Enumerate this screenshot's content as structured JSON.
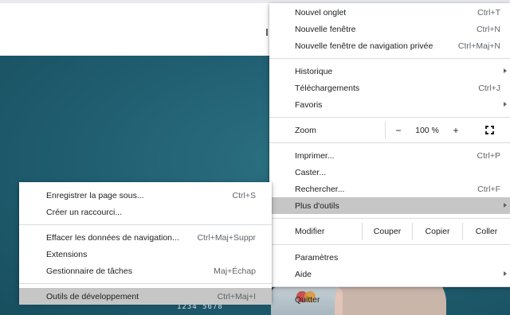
{
  "main_menu": {
    "items_group1": [
      {
        "label": "Nouvel onglet",
        "shortcut": "Ctrl+T"
      },
      {
        "label": "Nouvelle fenêtre",
        "shortcut": "Ctrl+N"
      },
      {
        "label": "Nouvelle fenêtre de navigation privée",
        "shortcut": "Ctrl+Maj+N"
      }
    ],
    "items_group2": [
      {
        "label": "Historique",
        "shortcut": ""
      },
      {
        "label": "Téléchargements",
        "shortcut": "Ctrl+J"
      },
      {
        "label": "Favoris",
        "shortcut": ""
      }
    ],
    "zoom": {
      "label": "Zoom",
      "minus": "−",
      "value": "100 %",
      "plus": "+"
    },
    "items_group3": [
      {
        "label": "Imprimer...",
        "shortcut": "Ctrl+P"
      },
      {
        "label": "Caster...",
        "shortcut": ""
      },
      {
        "label": "Rechercher...",
        "shortcut": "Ctrl+F"
      },
      {
        "label": "Plus d'outils",
        "shortcut": ""
      }
    ],
    "edit": {
      "label": "Modifier",
      "cut": "Couper",
      "copy": "Copier",
      "paste": "Coller"
    },
    "items_group4": [
      {
        "label": "Paramètres",
        "shortcut": ""
      },
      {
        "label": "Aide",
        "shortcut": ""
      }
    ],
    "quit": {
      "label": "Quitter"
    }
  },
  "sub_menu": {
    "group1": [
      {
        "label": "Enregistrer la page sous...",
        "shortcut": "Ctrl+S"
      },
      {
        "label": "Créer un raccourci...",
        "shortcut": ""
      }
    ],
    "group2": [
      {
        "label": "Effacer les données de navigation...",
        "shortcut": "Ctrl+Maj+Suppr"
      },
      {
        "label": "Extensions",
        "shortcut": ""
      },
      {
        "label": "Gestionnaire de tâches",
        "shortcut": "Maj+Échap"
      }
    ],
    "group3": [
      {
        "label": "Outils de développement",
        "shortcut": "Ctrl+Maj+I"
      }
    ]
  },
  "page": {
    "card_number": "1234 5678"
  }
}
